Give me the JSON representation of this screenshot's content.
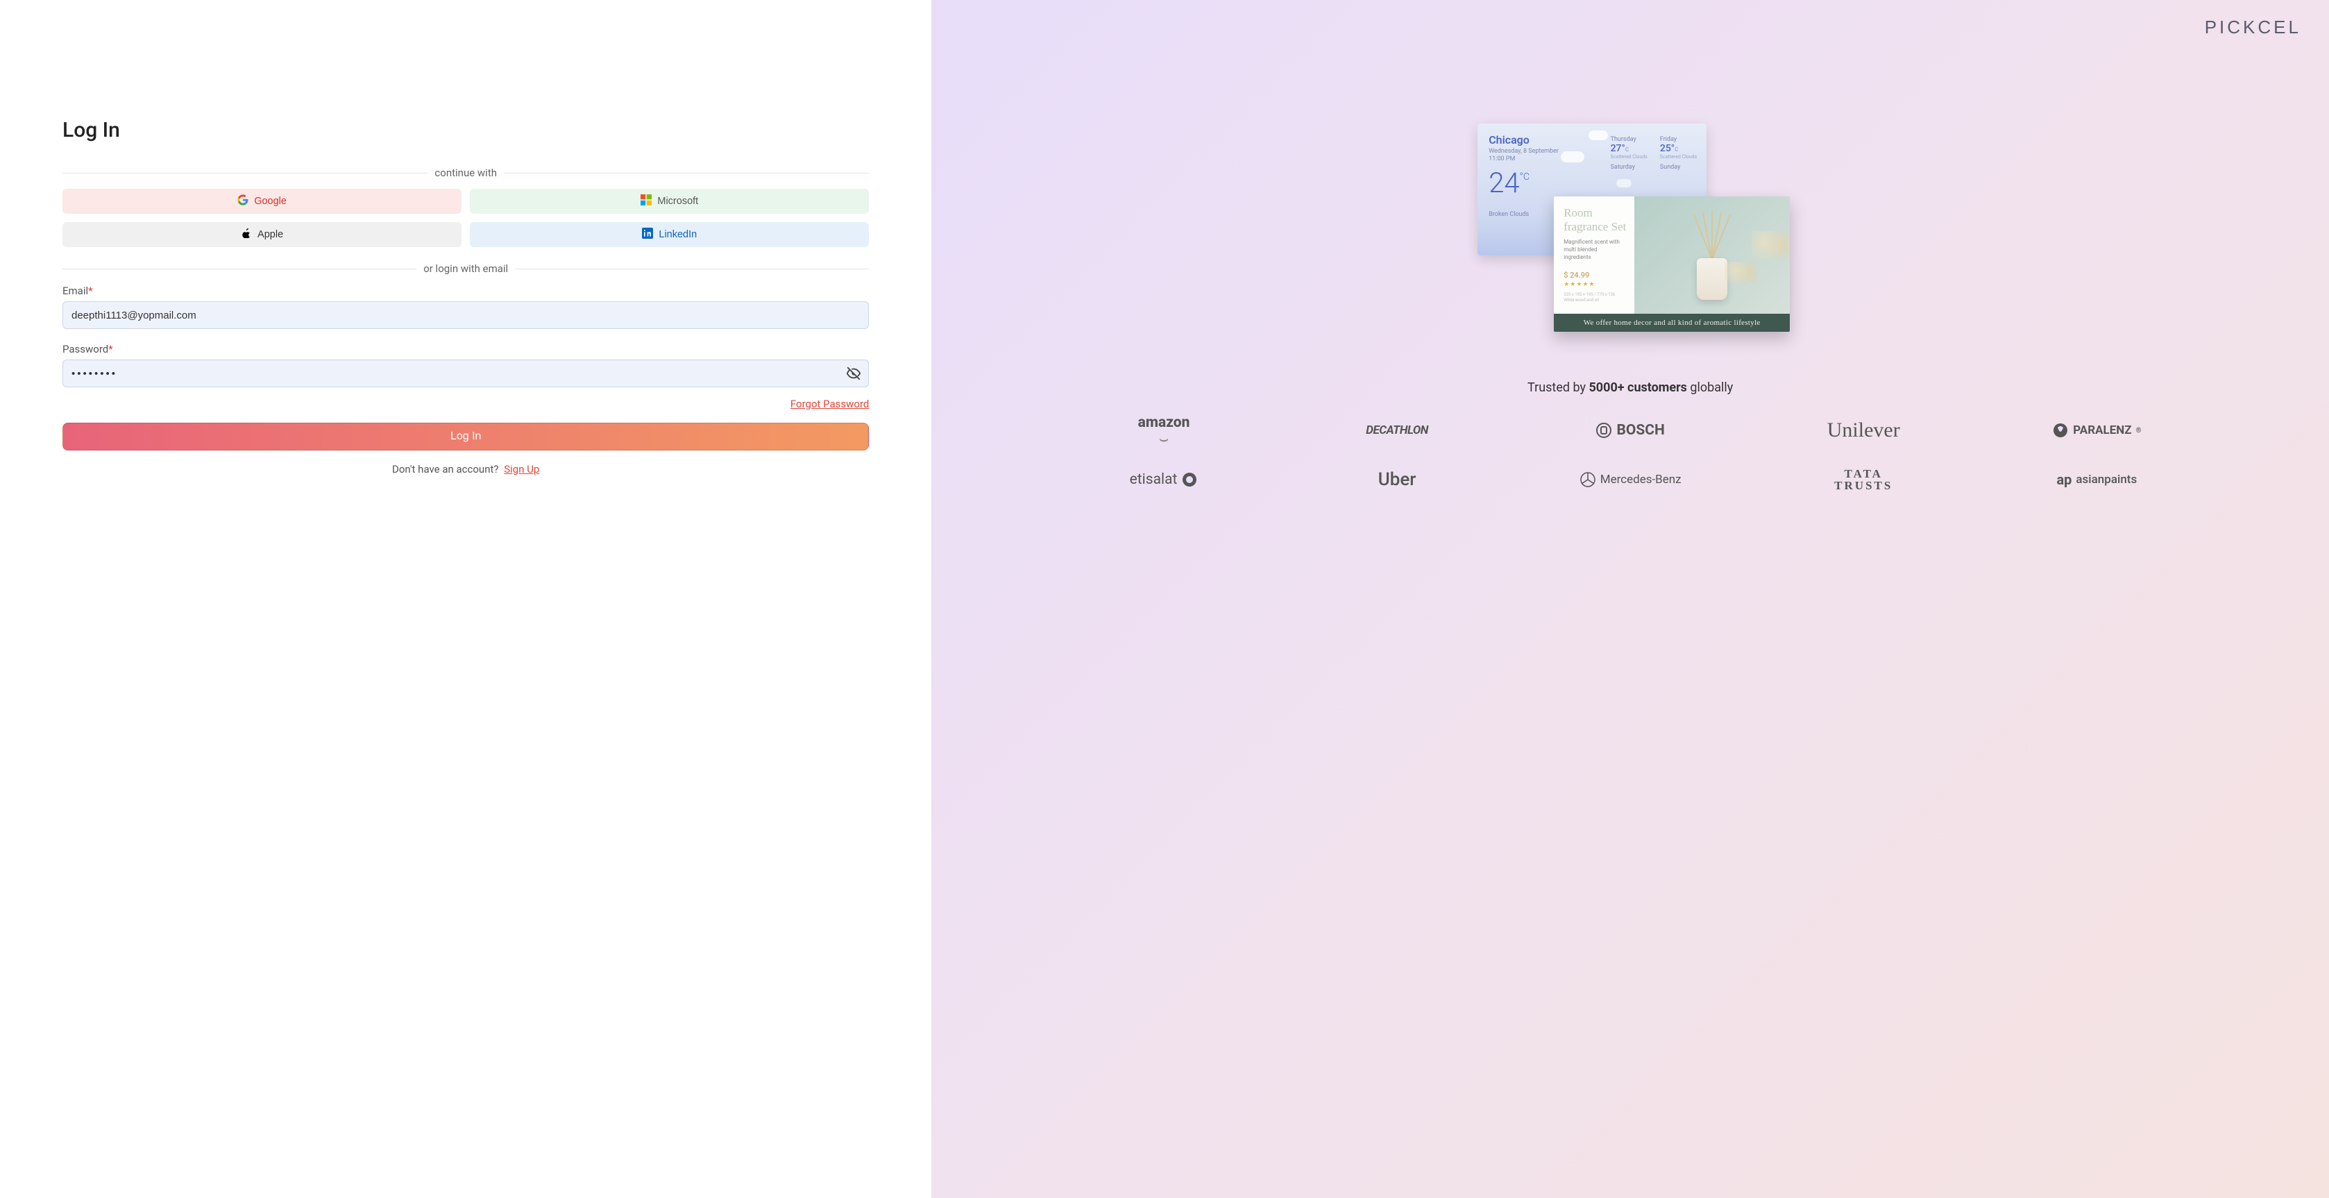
{
  "brand": "PICKCEL",
  "login": {
    "title": "Log In",
    "continue_with": "continue with",
    "or_email": "or login with email",
    "sso": {
      "google": "Google",
      "microsoft": "Microsoft",
      "apple": "Apple",
      "linkedin": "LinkedIn"
    },
    "email_label": "Email",
    "email_value": "deepthi1113@yopmail.com",
    "password_label": "Password",
    "password_value": "••••••••",
    "forgot": "Forgot Password",
    "submit": "Log In",
    "no_account": "Don't have an account?",
    "signup": "Sign Up"
  },
  "weather": {
    "city": "Chicago",
    "date": "Wednesday, 8 September",
    "time": "11:00 PM",
    "temp": "24",
    "unit": "°C",
    "condition": "Broken Clouds",
    "forecast": [
      {
        "day": "Thursday",
        "temp": "27°",
        "cond": "Scattered Clouds"
      },
      {
        "day": "Friday",
        "temp": "25°",
        "cond": "Scattered Clouds"
      },
      {
        "day": "Saturday",
        "temp": "",
        "cond": ""
      },
      {
        "day": "Sunday",
        "temp": "",
        "cond": ""
      }
    ]
  },
  "product": {
    "title_line1": "Room",
    "title_line2": "fragrance Set",
    "desc": "Magnificent scent with multi blended ingredients",
    "price": "$ 24.99",
    "stars": "★★★★★",
    "sku": "225 x 195 × 195 / 779 x 126",
    "sku2": "White wood and oil",
    "banner": "We offer home decor and all kind of aromatic lifestyle"
  },
  "trust": {
    "before": "Trusted by ",
    "bold": "5000+ customers",
    "after": " globally"
  },
  "logos": {
    "amazon": "amazon",
    "decathlon": "DECATHLON",
    "bosch": "BOSCH",
    "unilever": "Unilever",
    "paralenz": "PARALENZ",
    "etisalat": "etisalat",
    "uber": "Uber",
    "mercedes": "Mercedes-Benz",
    "tata1": "TATA",
    "tata2": "TRUSTS",
    "asianpaints": "asianpaints"
  }
}
